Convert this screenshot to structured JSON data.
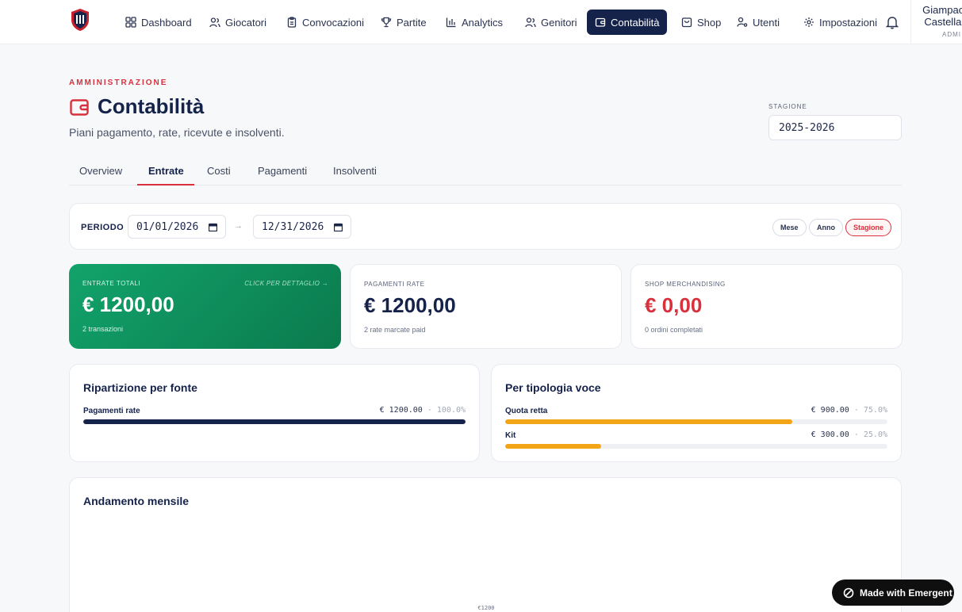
{
  "nav": {
    "items": [
      {
        "label": "Dashboard",
        "icon": "grid-icon"
      },
      {
        "label": "Giocatori",
        "icon": "users-icon"
      },
      {
        "label": "Convocazioni",
        "icon": "clipboard-icon"
      },
      {
        "label": "Partite",
        "icon": "trophy-icon"
      },
      {
        "label": "Analytics",
        "icon": "bar-chart-icon"
      },
      {
        "label": "Genitori",
        "icon": "family-icon"
      },
      {
        "label": "Contabilità",
        "icon": "wallet-icon"
      },
      {
        "label": "Shop",
        "icon": "bag-icon"
      },
      {
        "label": "Utenti",
        "icon": "user-key-icon"
      },
      {
        "label": "Impostazioni",
        "icon": "gear-icon"
      }
    ],
    "active": "Contabilità",
    "user": {
      "first": "Giampaol",
      "last": "Castellar",
      "role": "ADMI"
    }
  },
  "header": {
    "eyebrow": "AMMINISTRAZIONE",
    "title": "Contabilità",
    "subtitle": "Piani pagamento, rate, ricevute e insolventi.",
    "season_label": "STAGIONE",
    "season_value": "2025-2026"
  },
  "tabs": [
    "Overview",
    "Entrate",
    "Costi",
    "Pagamenti",
    "Insolventi"
  ],
  "active_tab": "Entrate",
  "period": {
    "label": "PERIODO",
    "from": "01/01/2026",
    "to": "12/31/2026",
    "arrow": "→",
    "presets": [
      "Mese",
      "Anno",
      "Stagione"
    ],
    "active_preset": "Stagione"
  },
  "stats": {
    "total": {
      "label": "ENTRATE TOTALI",
      "hint": "CLICK PER DETTAGLIO →",
      "value": "€ 1200,00",
      "sub": "2 transazioni"
    },
    "rate": {
      "label": "PAGAMENTI RATE",
      "value": "€ 1200,00",
      "sub": "2 rate marcate paid"
    },
    "shop": {
      "label": "SHOP MERCHANDISING",
      "value": "€ 0,00",
      "sub": "0 ordini completati"
    }
  },
  "by_source": {
    "title": "Ripartizione per fonte",
    "rows": [
      {
        "label": "Pagamenti rate",
        "amount": "€ 1200.00",
        "pct": "100.0%",
        "share": 1.0
      }
    ]
  },
  "by_type": {
    "title": "Per tipologia voce",
    "rows": [
      {
        "label": "Quota retta",
        "amount": "€ 900.00",
        "pct": "75.0%",
        "share": 0.75
      },
      {
        "label": "Kit",
        "amount": "€ 300.00",
        "pct": "25.0%",
        "share": 0.25
      }
    ]
  },
  "monthly": {
    "title": "Andamento mensile",
    "tick_label": "€1200"
  },
  "colors": {
    "navy": "#15224a",
    "accent_red": "#d8303c",
    "green": "#12a36a",
    "amber": "#f2a516"
  },
  "badge": {
    "label": "Made with Emergent"
  }
}
